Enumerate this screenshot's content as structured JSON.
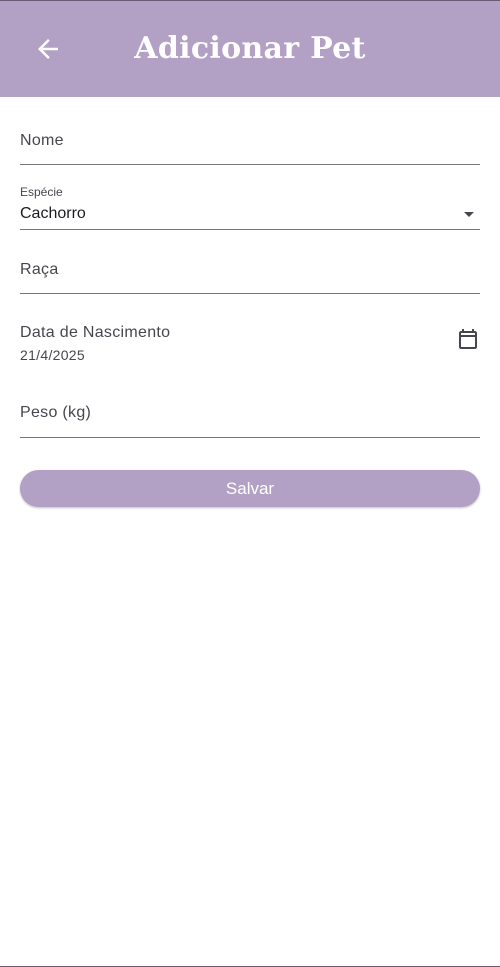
{
  "app_bar": {
    "title": "Adicionar Pet",
    "back_icon": "arrow-left-icon",
    "background": "#b3a1c5"
  },
  "form": {
    "name": {
      "label": "Nome",
      "value": ""
    },
    "species": {
      "label": "Espécie",
      "value": "Cachorro",
      "icon": "dropdown-arrow-icon"
    },
    "breed": {
      "label": "Raça",
      "value": ""
    },
    "birth_date": {
      "label": "Data de Nascimento",
      "value": "21/4/2025",
      "icon": "calendar-icon"
    },
    "weight": {
      "label": "Peso (kg)",
      "value": ""
    }
  },
  "actions": {
    "save_label": "Salvar",
    "button_color": "#b3a1c5"
  }
}
